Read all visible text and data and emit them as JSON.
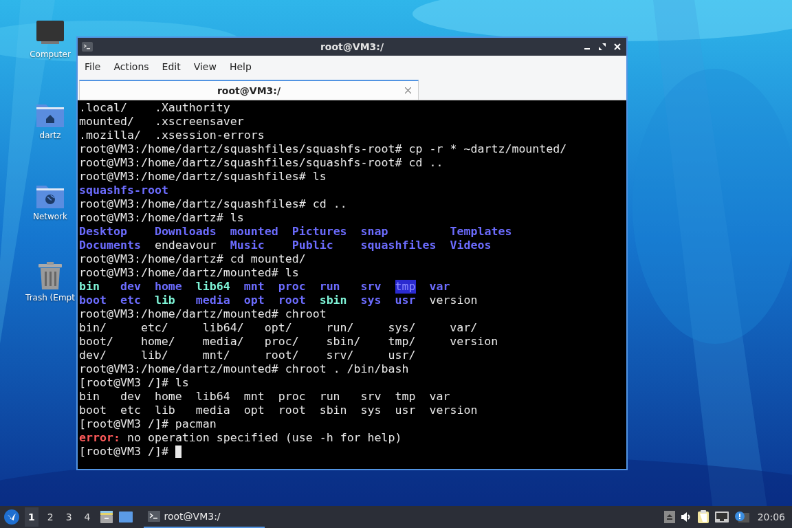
{
  "desktop": {
    "icons": [
      {
        "label": "Computer",
        "kind": "computer"
      },
      {
        "label": "dartz",
        "kind": "home"
      },
      {
        "label": "Network",
        "kind": "network"
      },
      {
        "label": "Trash (Empt",
        "kind": "trash"
      }
    ]
  },
  "window": {
    "title": "root@VM3:/",
    "menu": [
      "File",
      "Actions",
      "Edit",
      "View",
      "Help"
    ],
    "tabs": [
      {
        "label": "root@VM3:/",
        "selected": true
      }
    ],
    "terminal": {
      "cursor": true,
      "blocks": [
        {
          "kind": "ls",
          "rows": [
            [
              {
                "text": ".local/",
                "kind": "plain"
              },
              {
                "text": ".Xauthority",
                "kind": "plain"
              }
            ],
            [
              {
                "text": "mounted/",
                "kind": "plain"
              },
              {
                "text": ".xscreensaver",
                "kind": "plain"
              }
            ],
            [
              {
                "text": ".mozilla/",
                "kind": "plain"
              },
              {
                "text": ".xsession-errors",
                "kind": "plain"
              }
            ]
          ]
        },
        {
          "kind": "line",
          "segments": [
            {
              "text": "root@VM3:/home/dartz/squashfiles/squashfs-root# cp -r * ~dartz/mounted/",
              "kind": "plain"
            }
          ]
        },
        {
          "kind": "line",
          "segments": [
            {
              "text": "root@VM3:/home/dartz/squashfiles/squashfs-root# cd ..",
              "kind": "plain"
            }
          ]
        },
        {
          "kind": "line",
          "segments": [
            {
              "text": "root@VM3:/home/dartz/squashfiles# ls",
              "kind": "plain"
            }
          ]
        },
        {
          "kind": "ls",
          "rows": [
            [
              {
                "text": "squashfs-root",
                "kind": "dir"
              }
            ]
          ]
        },
        {
          "kind": "line",
          "segments": [
            {
              "text": "root@VM3:/home/dartz/squashfiles# cd ..",
              "kind": "plain"
            }
          ]
        },
        {
          "kind": "line",
          "segments": [
            {
              "text": "root@VM3:/home/dartz# ls",
              "kind": "plain"
            }
          ]
        },
        {
          "kind": "ls",
          "rows": [
            [
              {
                "text": "Desktop",
                "kind": "dir"
              },
              {
                "text": "Downloads",
                "kind": "dir"
              },
              {
                "text": "mounted",
                "kind": "dir"
              },
              {
                "text": "Pictures",
                "kind": "dir"
              },
              {
                "text": "snap",
                "kind": "dir"
              },
              {
                "text": "Templates",
                "kind": "dir"
              }
            ],
            [
              {
                "text": "Documents",
                "kind": "dir"
              },
              {
                "text": "endeavour",
                "kind": "plain"
              },
              {
                "text": "Music",
                "kind": "dir"
              },
              {
                "text": "Public",
                "kind": "dir"
              },
              {
                "text": "squashfiles",
                "kind": "dir"
              },
              {
                "text": "Videos",
                "kind": "dir"
              }
            ]
          ]
        },
        {
          "kind": "line",
          "segments": [
            {
              "text": "root@VM3:/home/dartz# cd mounted/",
              "kind": "plain"
            }
          ]
        },
        {
          "kind": "line",
          "segments": [
            {
              "text": "root@VM3:/home/dartz/mounted# ls",
              "kind": "plain"
            }
          ]
        },
        {
          "kind": "ls",
          "rows": [
            [
              {
                "text": "bin",
                "kind": "link"
              },
              {
                "text": "dev",
                "kind": "dir"
              },
              {
                "text": "home",
                "kind": "dir"
              },
              {
                "text": "lib64",
                "kind": "link"
              },
              {
                "text": "mnt",
                "kind": "dir"
              },
              {
                "text": "proc",
                "kind": "dir"
              },
              {
                "text": "run",
                "kind": "dir"
              },
              {
                "text": "srv",
                "kind": "dir"
              },
              {
                "text": "tmp",
                "kind": "sticky"
              },
              {
                "text": "var",
                "kind": "dir"
              }
            ],
            [
              {
                "text": "boot",
                "kind": "dir"
              },
              {
                "text": "etc",
                "kind": "dir"
              },
              {
                "text": "lib",
                "kind": "link"
              },
              {
                "text": "media",
                "kind": "dir"
              },
              {
                "text": "opt",
                "kind": "dir"
              },
              {
                "text": "root",
                "kind": "dir"
              },
              {
                "text": "sbin",
                "kind": "link"
              },
              {
                "text": "sys",
                "kind": "dir"
              },
              {
                "text": "usr",
                "kind": "dir"
              },
              {
                "text": "version",
                "kind": "plain"
              }
            ]
          ]
        },
        {
          "kind": "line",
          "segments": [
            {
              "text": "root@VM3:/home/dartz/mounted# chroot",
              "kind": "plain"
            }
          ]
        },
        {
          "kind": "completion",
          "rows": [
            [
              {
                "text": "bin/",
                "kind": "plain"
              },
              {
                "text": "etc/",
                "kind": "plain"
              },
              {
                "text": "lib64/",
                "kind": "plain"
              },
              {
                "text": "opt/",
                "kind": "plain"
              },
              {
                "text": "run/",
                "kind": "plain"
              },
              {
                "text": "sys/",
                "kind": "plain"
              },
              {
                "text": "var/",
                "kind": "plain"
              }
            ],
            [
              {
                "text": "boot/",
                "kind": "plain"
              },
              {
                "text": "home/",
                "kind": "plain"
              },
              {
                "text": "media/",
                "kind": "plain"
              },
              {
                "text": "proc/",
                "kind": "plain"
              },
              {
                "text": "sbin/",
                "kind": "plain"
              },
              {
                "text": "tmp/",
                "kind": "plain"
              },
              {
                "text": "version",
                "kind": "plain"
              }
            ],
            [
              {
                "text": "dev/",
                "kind": "plain"
              },
              {
                "text": "lib/",
                "kind": "plain"
              },
              {
                "text": "mnt/",
                "kind": "plain"
              },
              {
                "text": "root/",
                "kind": "plain"
              },
              {
                "text": "srv/",
                "kind": "plain"
              },
              {
                "text": "usr/",
                "kind": "plain"
              }
            ]
          ]
        },
        {
          "kind": "line",
          "segments": [
            {
              "text": "root@VM3:/home/dartz/mounted# chroot . /bin/bash",
              "kind": "plain"
            }
          ]
        },
        {
          "kind": "line",
          "segments": [
            {
              "text": "[root@VM3 /]# ls",
              "kind": "plain"
            }
          ]
        },
        {
          "kind": "ls",
          "rows": [
            [
              {
                "text": "bin",
                "kind": "plain"
              },
              {
                "text": "dev",
                "kind": "plain"
              },
              {
                "text": "home",
                "kind": "plain"
              },
              {
                "text": "lib64",
                "kind": "plain"
              },
              {
                "text": "mnt",
                "kind": "plain"
              },
              {
                "text": "proc",
                "kind": "plain"
              },
              {
                "text": "run",
                "kind": "plain"
              },
              {
                "text": "srv",
                "kind": "plain"
              },
              {
                "text": "tmp",
                "kind": "plain"
              },
              {
                "text": "var",
                "kind": "plain"
              }
            ],
            [
              {
                "text": "boot",
                "kind": "plain"
              },
              {
                "text": "etc",
                "kind": "plain"
              },
              {
                "text": "lib",
                "kind": "plain"
              },
              {
                "text": "media",
                "kind": "plain"
              },
              {
                "text": "opt",
                "kind": "plain"
              },
              {
                "text": "root",
                "kind": "plain"
              },
              {
                "text": "sbin",
                "kind": "plain"
              },
              {
                "text": "sys",
                "kind": "plain"
              },
              {
                "text": "usr",
                "kind": "plain"
              },
              {
                "text": "version",
                "kind": "plain"
              }
            ]
          ]
        },
        {
          "kind": "line",
          "segments": [
            {
              "text": "[root@VM3 /]# pacman",
              "kind": "plain"
            }
          ]
        },
        {
          "kind": "line",
          "segments": [
            {
              "text": "error:",
              "kind": "error"
            },
            {
              "text": " no operation specified (use -h for help)",
              "kind": "plain"
            }
          ]
        },
        {
          "kind": "line",
          "segments": [
            {
              "text": "[root@VM3 /]# ",
              "kind": "plain"
            }
          ]
        }
      ]
    }
  },
  "taskbar": {
    "workspaces": [
      {
        "label": "1",
        "selected": true
      },
      {
        "label": "2",
        "selected": false
      },
      {
        "label": "3",
        "selected": false
      },
      {
        "label": "4",
        "selected": false
      }
    ],
    "tasks": [
      {
        "title": "root@VM3:/",
        "active": true
      }
    ],
    "clock": "20:06"
  }
}
